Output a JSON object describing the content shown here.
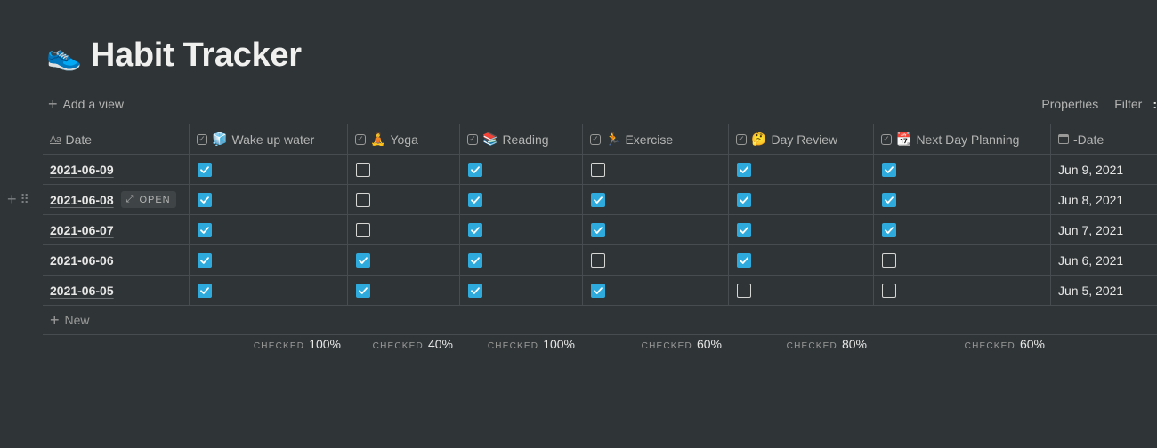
{
  "page": {
    "icon": "👟",
    "title": "Habit Tracker"
  },
  "toolbar": {
    "add_view": "Add a view",
    "properties": "Properties",
    "filter": "Filter"
  },
  "columns": [
    {
      "label": "Date",
      "icon": "text-title-icon"
    },
    {
      "label": "Wake up water",
      "emoji": "🧊",
      "icon": "checkbox-property-icon"
    },
    {
      "label": "Yoga",
      "emoji": "🧘",
      "icon": "checkbox-property-icon"
    },
    {
      "label": "Reading",
      "emoji": "📚",
      "icon": "checkbox-property-icon"
    },
    {
      "label": "Exercise",
      "emoji": "🏃",
      "icon": "checkbox-property-icon"
    },
    {
      "label": "Day Review",
      "emoji": "🤔",
      "icon": "checkbox-property-icon"
    },
    {
      "label": "Next Day Planning",
      "emoji": "📆",
      "icon": "checkbox-property-icon"
    },
    {
      "label": "-Date",
      "icon": "calendar-property-icon"
    }
  ],
  "rows": [
    {
      "title": "2021-06-09",
      "checks": [
        true,
        false,
        true,
        false,
        true,
        true
      ],
      "date": "Jun 9, 2021"
    },
    {
      "title": "2021-06-08",
      "checks": [
        true,
        false,
        true,
        true,
        true,
        true
      ],
      "date": "Jun 8, 2021",
      "hovered": true,
      "open_label": "OPEN"
    },
    {
      "title": "2021-06-07",
      "checks": [
        true,
        false,
        true,
        true,
        true,
        true
      ],
      "date": "Jun 7, 2021"
    },
    {
      "title": "2021-06-06",
      "checks": [
        true,
        true,
        true,
        false,
        true,
        false
      ],
      "date": "Jun 6, 2021"
    },
    {
      "title": "2021-06-05",
      "checks": [
        true,
        true,
        true,
        true,
        false,
        false
      ],
      "date": "Jun 5, 2021"
    }
  ],
  "new_row_label": "New",
  "calculations": [
    {
      "label": "CHECKED",
      "value": "100%"
    },
    {
      "label": "CHECKED",
      "value": "40%"
    },
    {
      "label": "CHECKED",
      "value": "100%"
    },
    {
      "label": "CHECKED",
      "value": "60%"
    },
    {
      "label": "CHECKED",
      "value": "80%"
    },
    {
      "label": "CHECKED",
      "value": "60%"
    }
  ],
  "colors": {
    "background": "#2f3437",
    "checkbox_checked": "#2eaadc",
    "text": "#e6e6e5",
    "muted": "#9a9b99"
  }
}
